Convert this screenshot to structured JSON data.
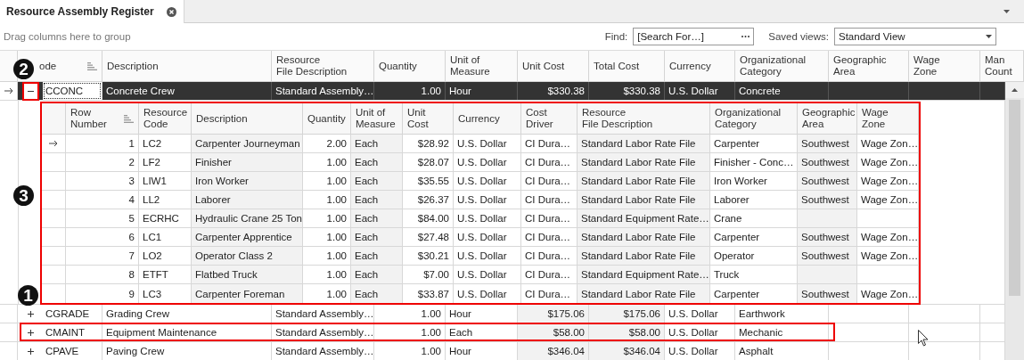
{
  "tab": {
    "title": "Resource Assembly Register",
    "selected": true
  },
  "group_panel": {
    "hint": "Drag columns here to group"
  },
  "find": {
    "label": "Find:",
    "placeholder": "[Search For…]"
  },
  "saved_views": {
    "label": "Saved views:",
    "value": "Standard View"
  },
  "columns": [
    {
      "label": "ode",
      "sorted": true
    },
    {
      "label": "Description"
    },
    {
      "label": "Resource\nFile Description"
    },
    {
      "label": "Quantity"
    },
    {
      "label": "Unit of\nMeasure"
    },
    {
      "label": "Unit Cost"
    },
    {
      "label": "Total Cost"
    },
    {
      "label": "Currency"
    },
    {
      "label": "Organizational\nCategory"
    },
    {
      "label": "Geographic\nArea"
    },
    {
      "label": "Wage\nZone"
    },
    {
      "label": "Man\nCount"
    }
  ],
  "rows": [
    {
      "current": true,
      "selected": true,
      "expanded": true,
      "highlighted": false,
      "cells": [
        "CCONC",
        "Concrete Crew",
        "Standard Assembly…",
        "1.00",
        "Hour",
        "$330.38",
        "$330.38",
        "U.S. Dollar",
        "Concrete"
      ],
      "detail": {
        "highlighted": true,
        "columns": [
          {
            "label": "Row\nNumber",
            "sorted": true
          },
          {
            "label": "Resource\nCode"
          },
          {
            "label": "Description"
          },
          {
            "label": "Quantity"
          },
          {
            "label": "Unit of\nMeasure"
          },
          {
            "label": "Unit Cost"
          },
          {
            "label": "Currency"
          },
          {
            "label": "Cost\nDriver"
          },
          {
            "label": "Resource\nFile Description"
          },
          {
            "label": "Organizational\nCategory"
          },
          {
            "label": "Geographic\nArea"
          },
          {
            "label": "Wage\nZone"
          }
        ],
        "rows": [
          {
            "current": true,
            "cells": [
              "1",
              "LC2",
              "Carpenter Journeyman",
              "2.00",
              "Each",
              "$28.92",
              "U.S. Dollar",
              "CI Dura…",
              "Standard Labor Rate File",
              "Carpenter",
              "Southwest",
              "Wage Zon…"
            ]
          },
          {
            "current": false,
            "cells": [
              "2",
              "LF2",
              "Finisher",
              "1.00",
              "Each",
              "$28.07",
              "U.S. Dollar",
              "CI Dura…",
              "Standard Labor Rate File",
              "Finisher - Conc…",
              "Southwest",
              "Wage Zon…"
            ]
          },
          {
            "current": false,
            "cells": [
              "3",
              "LIW1",
              "Iron Worker",
              "1.00",
              "Each",
              "$35.55",
              "U.S. Dollar",
              "CI Dura…",
              "Standard Labor Rate File",
              "Iron Worker",
              "Southwest",
              "Wage Zon…"
            ]
          },
          {
            "current": false,
            "cells": [
              "4",
              "LL2",
              "Laborer",
              "1.00",
              "Each",
              "$26.37",
              "U.S. Dollar",
              "CI Dura…",
              "Standard Labor Rate File",
              "Laborer",
              "Southwest",
              "Wage Zon…"
            ]
          },
          {
            "current": false,
            "cells": [
              "5",
              "ECRHC",
              "Hydraulic Crane 25 Ton",
              "1.00",
              "Each",
              "$84.00",
              "U.S. Dollar",
              "CI Dura…",
              "Standard Equipment Rate…",
              "Crane"
            ]
          },
          {
            "current": false,
            "cells": [
              "6",
              "LC1",
              "Carpenter Apprentice",
              "1.00",
              "Each",
              "$27.48",
              "U.S. Dollar",
              "CI Dura…",
              "Standard Labor Rate File",
              "Carpenter",
              "Southwest",
              "Wage Zon…"
            ]
          },
          {
            "current": false,
            "cells": [
              "7",
              "LO2",
              "Operator Class 2",
              "1.00",
              "Each",
              "$30.21",
              "U.S. Dollar",
              "CI Dura…",
              "Standard Labor Rate File",
              "Operator",
              "Southwest",
              "Wage Zon…"
            ]
          },
          {
            "current": false,
            "cells": [
              "8",
              "ETFT",
              "Flatbed Truck",
              "1.00",
              "Each",
              "$7.00",
              "U.S. Dollar",
              "CI Dura…",
              "Standard Equipment Rate…",
              "Truck"
            ]
          },
          {
            "current": false,
            "cells": [
              "9",
              "LC3",
              "Carpenter Foreman",
              "1.00",
              "Each",
              "$33.87",
              "U.S. Dollar",
              "CI Dura…",
              "Standard Labor Rate File",
              "Carpenter",
              "Southwest",
              "Wage Zon…"
            ]
          }
        ]
      }
    },
    {
      "current": false,
      "selected": false,
      "expanded": false,
      "highlighted": false,
      "cells": [
        "CGRADE",
        "Grading Crew",
        "Standard Assembly…",
        "1.00",
        "Hour",
        "$175.06",
        "$175.06",
        "U.S. Dollar",
        "Earthwork"
      ]
    },
    {
      "current": false,
      "selected": false,
      "expanded": false,
      "highlighted": true,
      "cells": [
        "CMAINT",
        "Equipment Maintenance",
        "Standard Assembly…",
        "1.00",
        "Each",
        "$58.00",
        "$58.00",
        "U.S. Dollar",
        "Mechanic"
      ]
    },
    {
      "current": false,
      "selected": false,
      "expanded": false,
      "highlighted": false,
      "cells": [
        "CPAVE",
        "Paving Crew",
        "Standard Assembly…",
        "1.00",
        "Hour",
        "$346.04",
        "$346.04",
        "U.S. Dollar",
        "Asphalt"
      ]
    }
  ],
  "annotations": [
    {
      "label": "2"
    },
    {
      "label": "3"
    },
    {
      "label": "1"
    }
  ]
}
